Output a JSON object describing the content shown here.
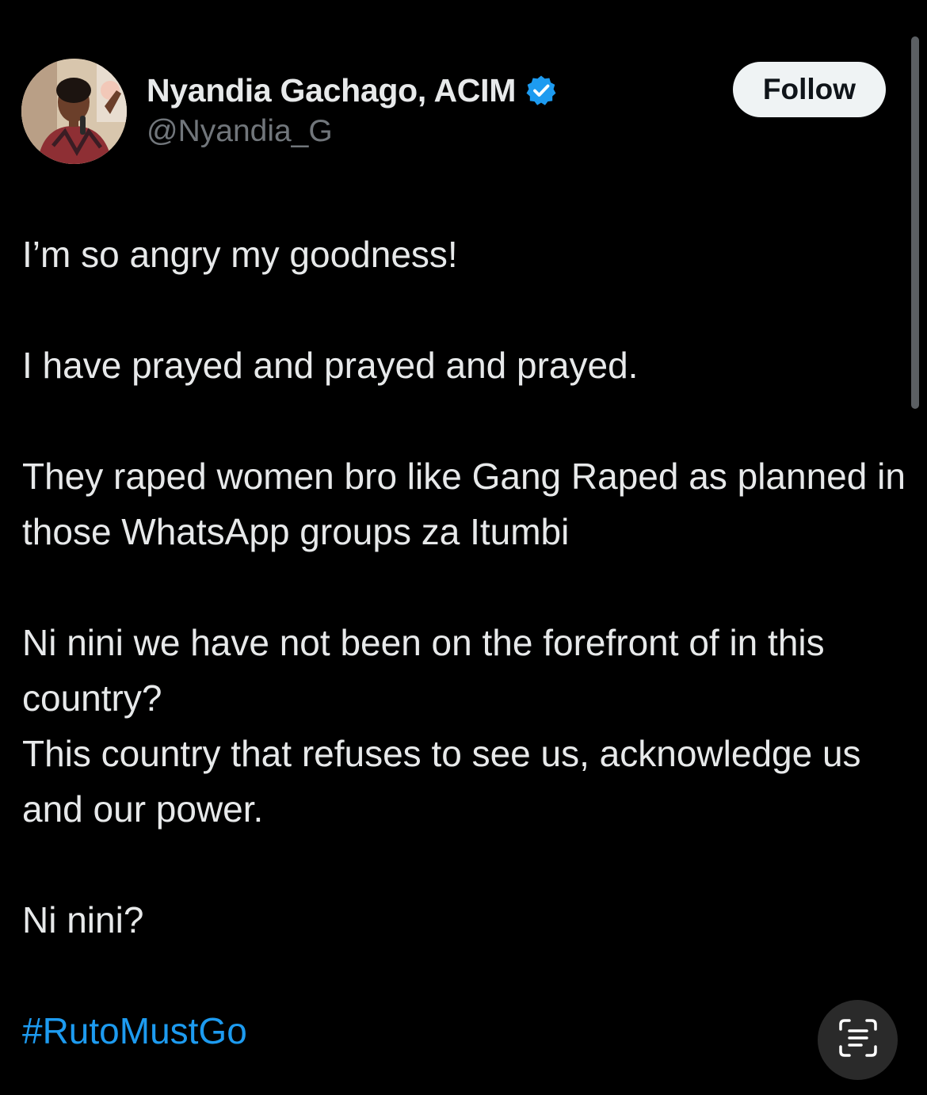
{
  "author": {
    "display_name": "Nyandia Gachago, ACIM",
    "handle": "@Nyandia_G",
    "verified": true,
    "verified_color": "#1d9bf0"
  },
  "follow_button": {
    "label": "Follow"
  },
  "tweet": {
    "paragraphs": [
      "I’m so angry my goodness!",
      "I have prayed and prayed and prayed.",
      "They raped women bro like Gang Raped as planned in those WhatsApp groups za Itumbi",
      "Ni nini we have not been on the forefront of in this country?",
      "This country that refuses to see us, acknowledge us and our power.",
      "Ni nini?"
    ],
    "hashtag": "#RutoMustGo",
    "hashtag_color": "#1d9bf0"
  },
  "icons": {
    "verified": "verified-badge-icon",
    "scan": "live-text-scan-icon"
  },
  "colors": {
    "background": "#000000",
    "text": "#e7e9ea",
    "secondary_text": "#71767b",
    "follow_bg": "#eff3f4"
  }
}
